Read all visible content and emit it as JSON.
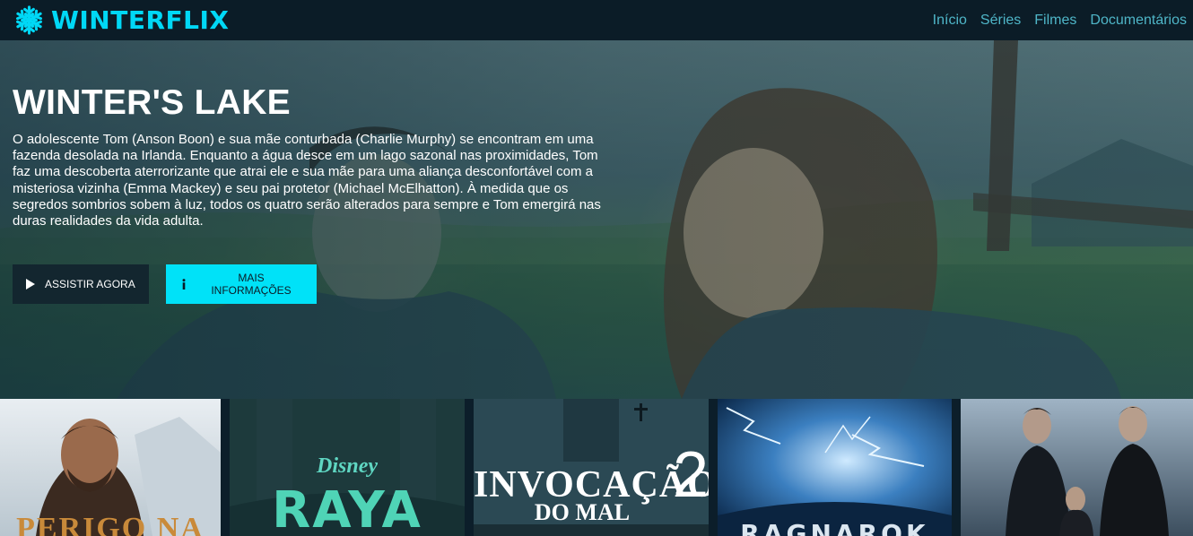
{
  "brand": {
    "name": "WINTERFLIX",
    "icon": "snowflake-icon",
    "accent": "#00d8f6"
  },
  "nav": [
    {
      "label": "Início"
    },
    {
      "label": "Séries"
    },
    {
      "label": "Filmes"
    },
    {
      "label": "Documentários"
    }
  ],
  "hero": {
    "title": "WINTER'S LAKE",
    "description": "O adolescente Tom (Anson Boon) e sua mãe conturbada (Charlie Murphy) se encontram em uma fazenda desolada na Irlanda. Enquanto a água desce em um lago sazonal nas proximidades, Tom faz uma descoberta aterrorizante que atrai ele e sua mãe para uma aliança desconfortável com a misteriosa vizinha (Emma Mackey) e seu pai protetor (Michael McElhatton). À medida que os segredos sombrios sobem à luz, todos os quatro serão alterados para sempre e Tom emergirá nas duras realidades da vida adulta.",
    "play_label": "ASSISTIR AGORA",
    "info_label": "MAIS INFORMAÇÕES",
    "play_icon": "play-icon",
    "info_icon": "info-icon"
  },
  "posters": [
    {
      "title_text": "PERIGO NA"
    },
    {
      "brand_text": "Disney",
      "title_text": "RAYA"
    },
    {
      "title_text": "INVOCAÇÃO",
      "subtitle_text": "DO MAL",
      "number_text": "2"
    },
    {
      "title_text": "RAGNAROK"
    },
    {
      "title_text": ""
    }
  ]
}
